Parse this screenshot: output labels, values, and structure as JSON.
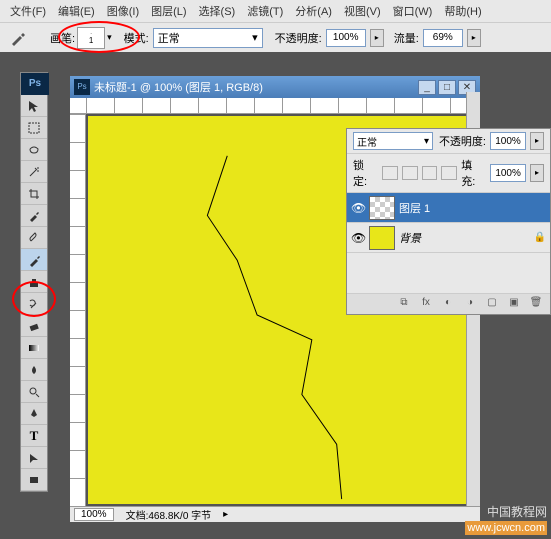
{
  "menu": [
    "文件(F)",
    "编辑(E)",
    "图像(I)",
    "图层(L)",
    "选择(S)",
    "滤镜(T)",
    "分析(A)",
    "视图(V)",
    "窗口(W)",
    "帮助(H)"
  ],
  "optionsBar": {
    "brush_label": "画笔:",
    "brush_size": "1",
    "mode_label": "模式:",
    "mode_value": "正常",
    "opacity_label": "不透明度:",
    "opacity_value": "100%",
    "flow_label": "流量:",
    "flow_value": "69%"
  },
  "document": {
    "title": "未标题-1 @ 100% (图层 1, RGB/8)",
    "zoom": "100%",
    "status": "文档:468.8K/0 字节"
  },
  "layersPanel": {
    "blend_mode": "正常",
    "opacity_label": "不透明度:",
    "opacity_value": "100%",
    "lock_label": "锁定:",
    "fill_label": "填充:",
    "fill_value": "100%",
    "layers": [
      {
        "name": "图层 1",
        "selected": true,
        "thumb": "checker",
        "locked": false
      },
      {
        "name": "背景",
        "selected": false,
        "thumb": "yellow",
        "italic": true,
        "locked": true
      }
    ]
  },
  "watermark": {
    "line1": "中国教程网",
    "url": "www.jcwcn.com"
  },
  "tools": [
    "↖",
    "▭",
    "☐",
    "✂",
    "⬚",
    "⟳",
    "✎",
    "●",
    "▢",
    "🖍",
    "⬛",
    "⬜",
    "T",
    "⬡",
    "✱",
    "⤢"
  ]
}
